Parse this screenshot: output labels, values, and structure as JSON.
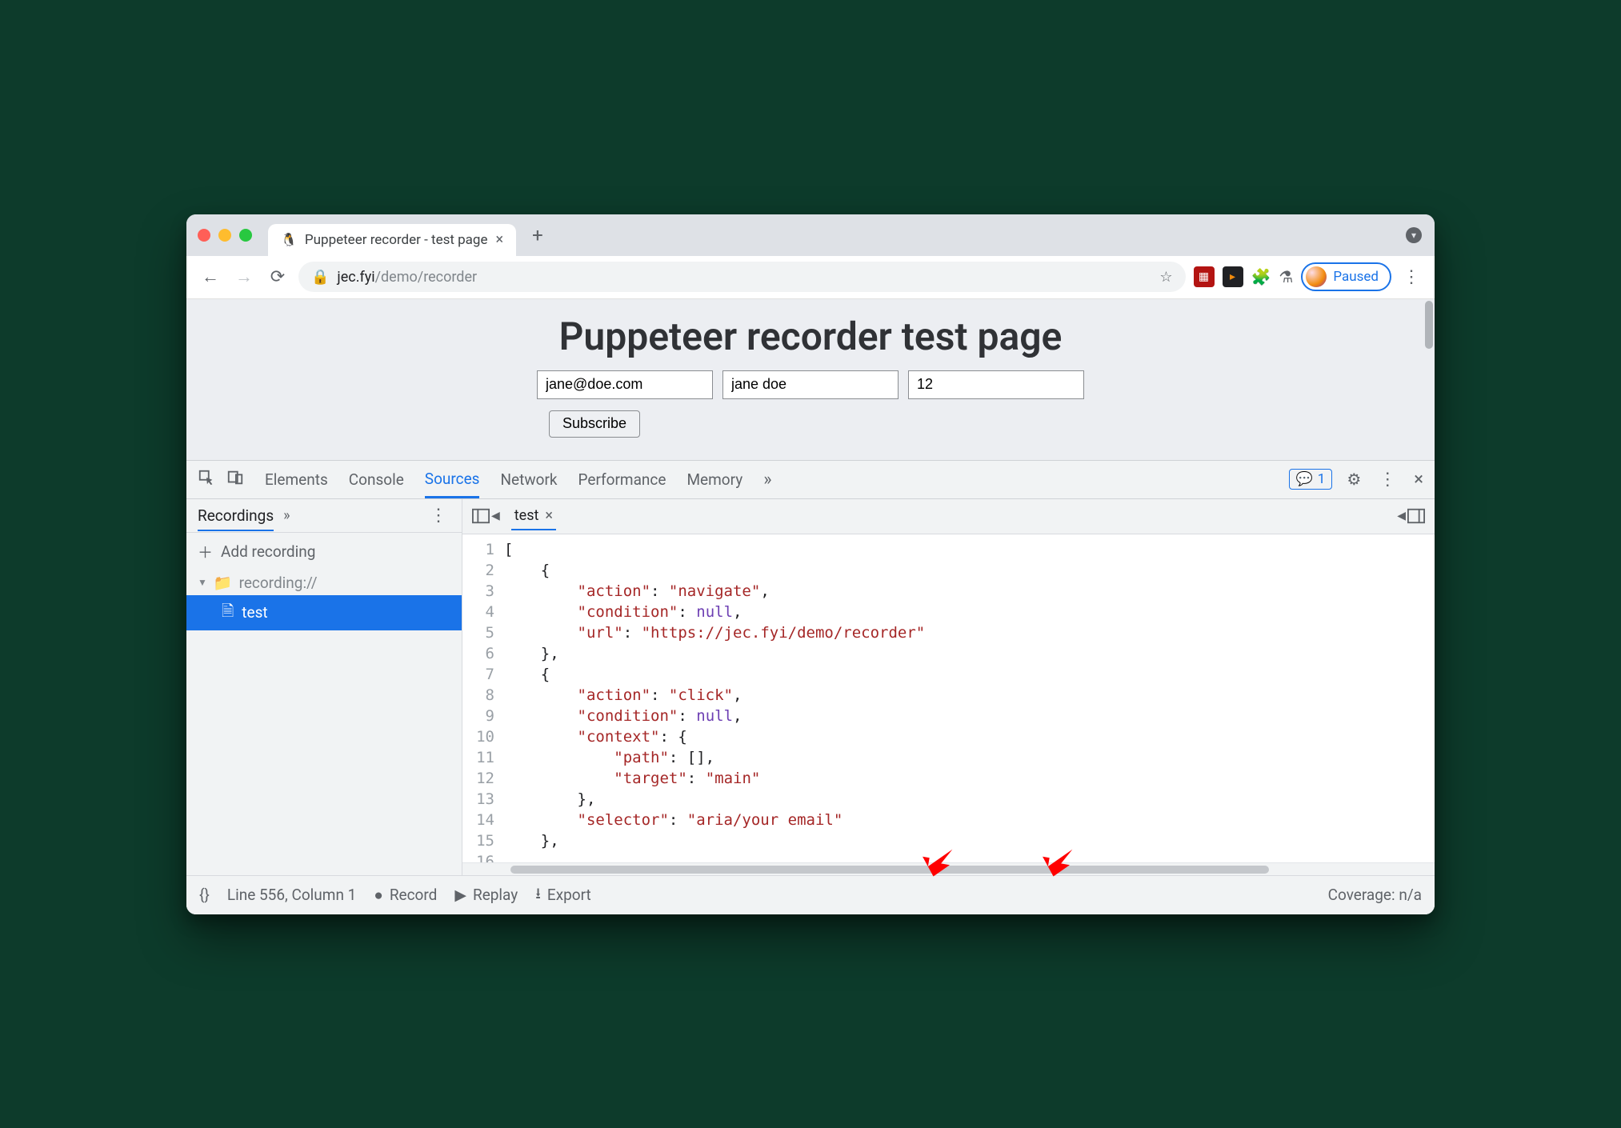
{
  "titlebar": {
    "tab_title": "Puppeteer recorder - test page",
    "tab_favicon": "🐧"
  },
  "toolbar": {
    "url_host": "jec.fyi",
    "url_path": "/demo/recorder",
    "profile_status": "Paused"
  },
  "page": {
    "heading": "Puppeteer recorder test page",
    "email": "jane@doe.com",
    "name": "jane doe",
    "age": "12",
    "subscribe_label": "Subscribe"
  },
  "devtools": {
    "tabs": [
      "Elements",
      "Console",
      "Sources",
      "Network",
      "Performance",
      "Memory"
    ],
    "active_tab": "Sources",
    "messages_badge": "1",
    "sidebar": {
      "panel_title": "Recordings",
      "add_label": "Add recording",
      "scheme": "recording://",
      "file": "test"
    },
    "editor_tab": "test",
    "code_lines": [
      "[",
      "    {",
      "        \"action\": \"navigate\",",
      "        \"condition\": null,",
      "        \"url\": \"https://jec.fyi/demo/recorder\"",
      "    },",
      "    {",
      "        \"action\": \"click\",",
      "        \"condition\": null,",
      "        \"context\": {",
      "            \"path\": [],",
      "            \"target\": \"main\"",
      "        },",
      "        \"selector\": \"aria/your email\"",
      "    },",
      ""
    ],
    "status": {
      "format_label": "{}",
      "cursor": "Line 556, Column 1",
      "record": "Record",
      "replay": "Replay",
      "export": "Export",
      "coverage": "Coverage: n/a"
    }
  }
}
